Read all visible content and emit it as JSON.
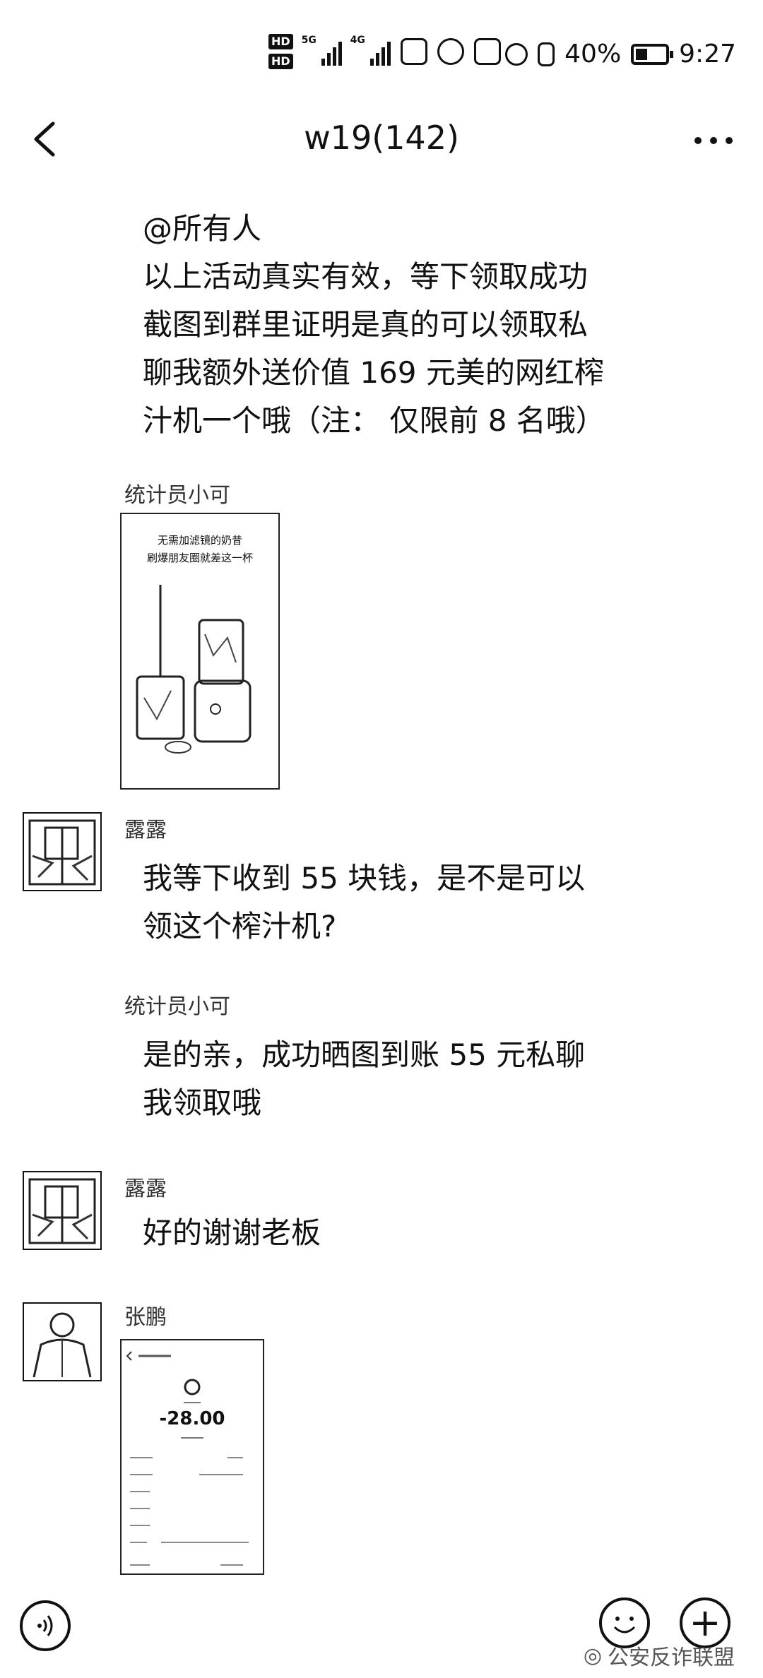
{
  "status_bar": {
    "hd1": "HD",
    "hd2": "HD",
    "signal1_label": "5G",
    "signal2_label": "4G",
    "battery_text": "40%",
    "battery_level": 0.4,
    "time": "9:27"
  },
  "header": {
    "title": "w19(142)"
  },
  "messages": {
    "m1": {
      "lines": [
        "@所有人",
        "以上活动真实有效，等下领取成功",
        "截图到群里证明是真的可以领取私",
        "聊我额外送价值 169 元美的网红榨",
        "汁机一个哦（注：  仅限前 8 名哦）"
      ]
    },
    "m2": {
      "sender": "统计员小可",
      "image": {
        "headline1": "无需加滤镜的奶昔",
        "headline2": "刷爆朋友圈就差这一杯"
      }
    },
    "m3": {
      "sender": "露露",
      "lines": [
        "我等下收到 55 块钱，是不是可以",
        "领这个榨汁机?"
      ]
    },
    "m4": {
      "sender": "统计员小可",
      "lines": [
        "是的亲，成功晒图到账 55 元私聊",
        "我领取哦"
      ]
    },
    "m5": {
      "sender": "露露",
      "lines": [
        "好的谢谢老板"
      ]
    },
    "m6": {
      "sender": "张鹏",
      "receipt": {
        "amount": "-28.00"
      }
    }
  },
  "bottom_bar": {
    "plus": "+"
  },
  "watermark": {
    "text": "公安反诈联盟"
  }
}
